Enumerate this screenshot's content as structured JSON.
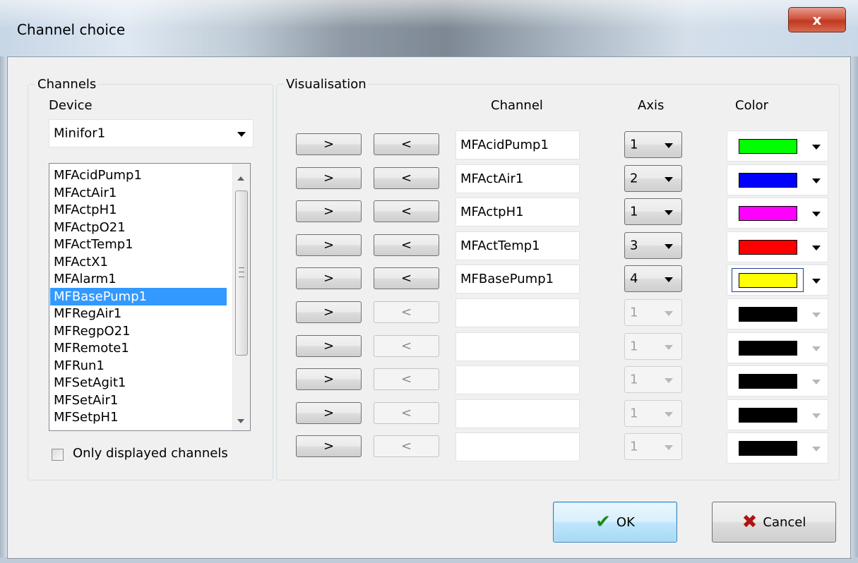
{
  "window": {
    "title": "Channel choice",
    "close_symbol": "x"
  },
  "channels_group": {
    "label": "Channels",
    "device_label": "Device",
    "device_value": "Minifor1",
    "list_items": [
      "MFAcidPump1",
      "MFActAir1",
      "MFActpH1",
      "MFActpO21",
      "MFActTemp1",
      "MFActX1",
      "MFAlarm1",
      "MFBasePump1",
      "MFRegAir1",
      "MFRegpO21",
      "MFRemote1",
      "MFRun1",
      "MFSetAgit1",
      "MFSetAir1",
      "MFSetpH1"
    ],
    "selected_item": "MFBasePump1",
    "only_displayed_label": "Only displayed channels",
    "only_displayed_checked": false
  },
  "visualisation_group": {
    "label": "Visualisation",
    "col_channel": "Channel",
    "col_axis": "Axis",
    "col_color": "Color",
    "add_label": ">",
    "remove_label": "<",
    "rows": [
      {
        "channel": "MFAcidPump1",
        "axis": "1",
        "color": "#00ff00",
        "enabled": true
      },
      {
        "channel": "MFActAir1",
        "axis": "2",
        "color": "#0000ff",
        "enabled": true
      },
      {
        "channel": "MFActpH1",
        "axis": "1",
        "color": "#ff00ff",
        "enabled": true
      },
      {
        "channel": "MFActTemp1",
        "axis": "3",
        "color": "#ff0000",
        "enabled": true
      },
      {
        "channel": "MFBasePump1",
        "axis": "4",
        "color": "#ffff00",
        "enabled": true,
        "focused": true
      },
      {
        "channel": "",
        "axis": "1",
        "color": "#000000",
        "enabled": false
      },
      {
        "channel": "",
        "axis": "1",
        "color": "#000000",
        "enabled": false
      },
      {
        "channel": "",
        "axis": "1",
        "color": "#000000",
        "enabled": false
      },
      {
        "channel": "",
        "axis": "1",
        "color": "#000000",
        "enabled": false
      },
      {
        "channel": "",
        "axis": "1",
        "color": "#000000",
        "enabled": false
      }
    ]
  },
  "footer": {
    "ok_label": "OK",
    "cancel_label": "Cancel"
  }
}
